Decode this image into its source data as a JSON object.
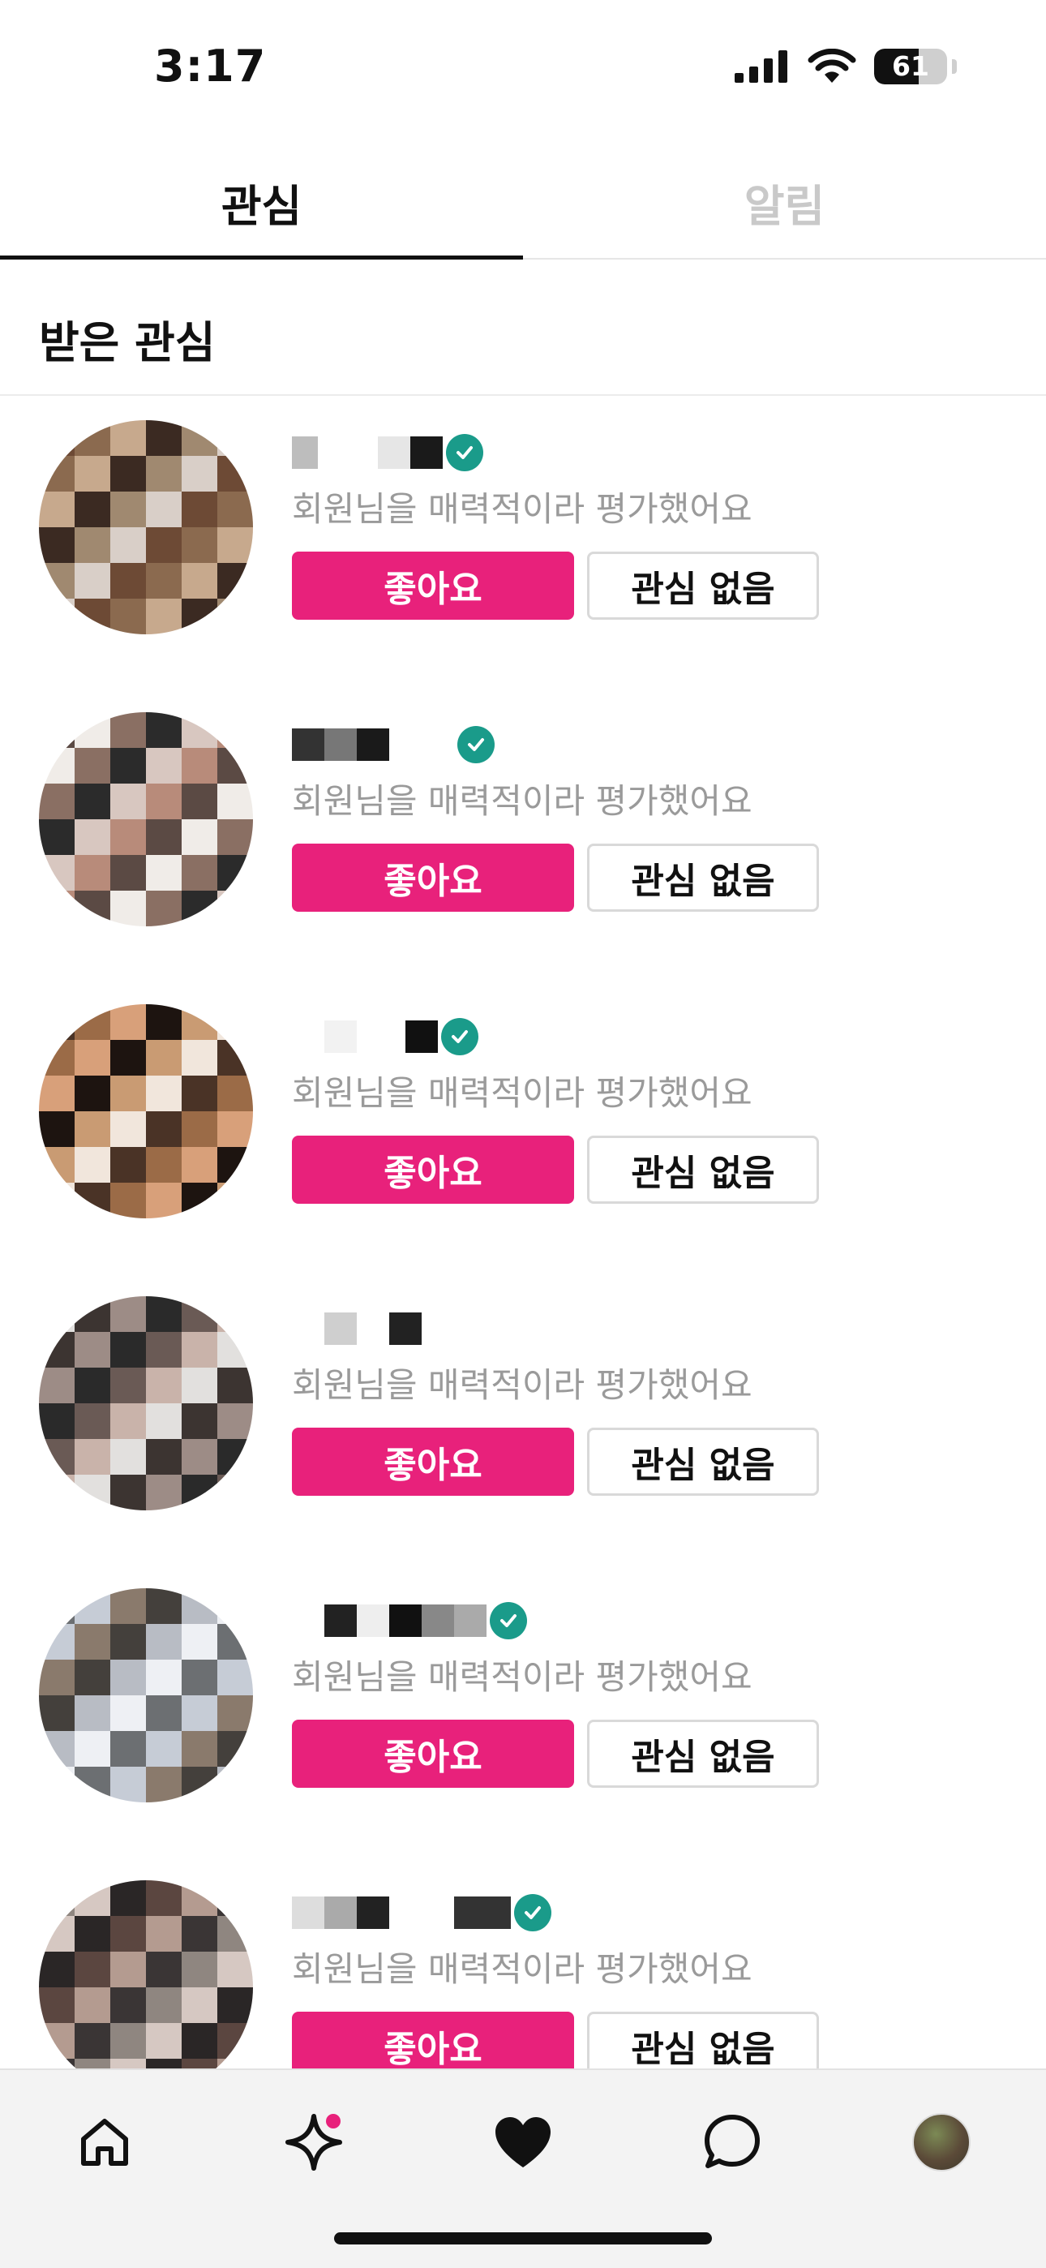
{
  "status_bar": {
    "time": "3:17",
    "battery": "61",
    "battery_level": 0.61
  },
  "tabs": [
    {
      "label": "관심",
      "active": true
    },
    {
      "label": "알림",
      "active": false
    }
  ],
  "section": {
    "title": "받은 관심"
  },
  "list": [
    {
      "description": "회원님을 매력적이라 평가했어요",
      "like_label": "좋아요",
      "pass_label": "관심 없음",
      "verified": true
    },
    {
      "description": "회원님을 매력적이라 평가했어요",
      "like_label": "좋아요",
      "pass_label": "관심 없음",
      "verified": true
    },
    {
      "description": "회원님을 매력적이라 평가했어요",
      "like_label": "좋아요",
      "pass_label": "관심 없음",
      "verified": true
    },
    {
      "description": "회원님을 매력적이라 평가했어요",
      "like_label": "좋아요",
      "pass_label": "관심 없음",
      "verified": false
    },
    {
      "description": "회원님을 매력적이라 평가했어요",
      "like_label": "좋아요",
      "pass_label": "관심 없음",
      "verified": true
    },
    {
      "description": "회원님을 매력적이라 평가했어요",
      "like_label": "좋아요",
      "pass_label": "관심 없음",
      "verified": true
    }
  ],
  "bottom_nav": [
    {
      "icon": "home-icon",
      "badge": false
    },
    {
      "icon": "sparkle-icon",
      "badge": true
    },
    {
      "icon": "heart-icon",
      "badge": false
    },
    {
      "icon": "chat-icon",
      "badge": false
    },
    {
      "icon": "profile-avatar",
      "badge": false
    }
  ],
  "colors": {
    "accent": "#e8217b",
    "verified": "#1a9b8a",
    "muted_text": "#9a9a9a",
    "inactive_tab": "#c9c9c9"
  }
}
